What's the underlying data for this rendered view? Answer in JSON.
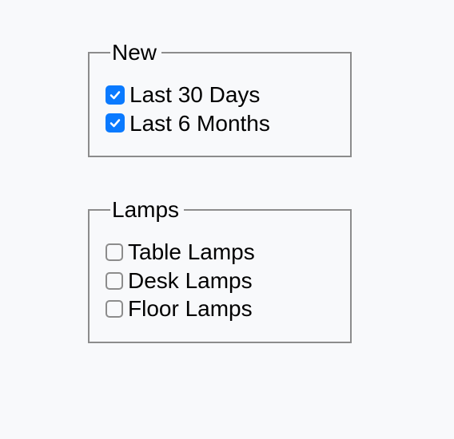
{
  "groups": [
    {
      "legend": "New",
      "name": "new",
      "options": [
        {
          "label": "Last 30 Days",
          "checked": true,
          "name": "last-30-days"
        },
        {
          "label": "Last 6 Months",
          "checked": true,
          "name": "last-6-months"
        }
      ]
    },
    {
      "legend": "Lamps",
      "name": "lamps",
      "options": [
        {
          "label": "Table Lamps",
          "checked": false,
          "name": "table-lamps"
        },
        {
          "label": "Desk Lamps",
          "checked": false,
          "name": "desk-lamps"
        },
        {
          "label": "Floor Lamps",
          "checked": false,
          "name": "floor-lamps"
        }
      ]
    }
  ]
}
